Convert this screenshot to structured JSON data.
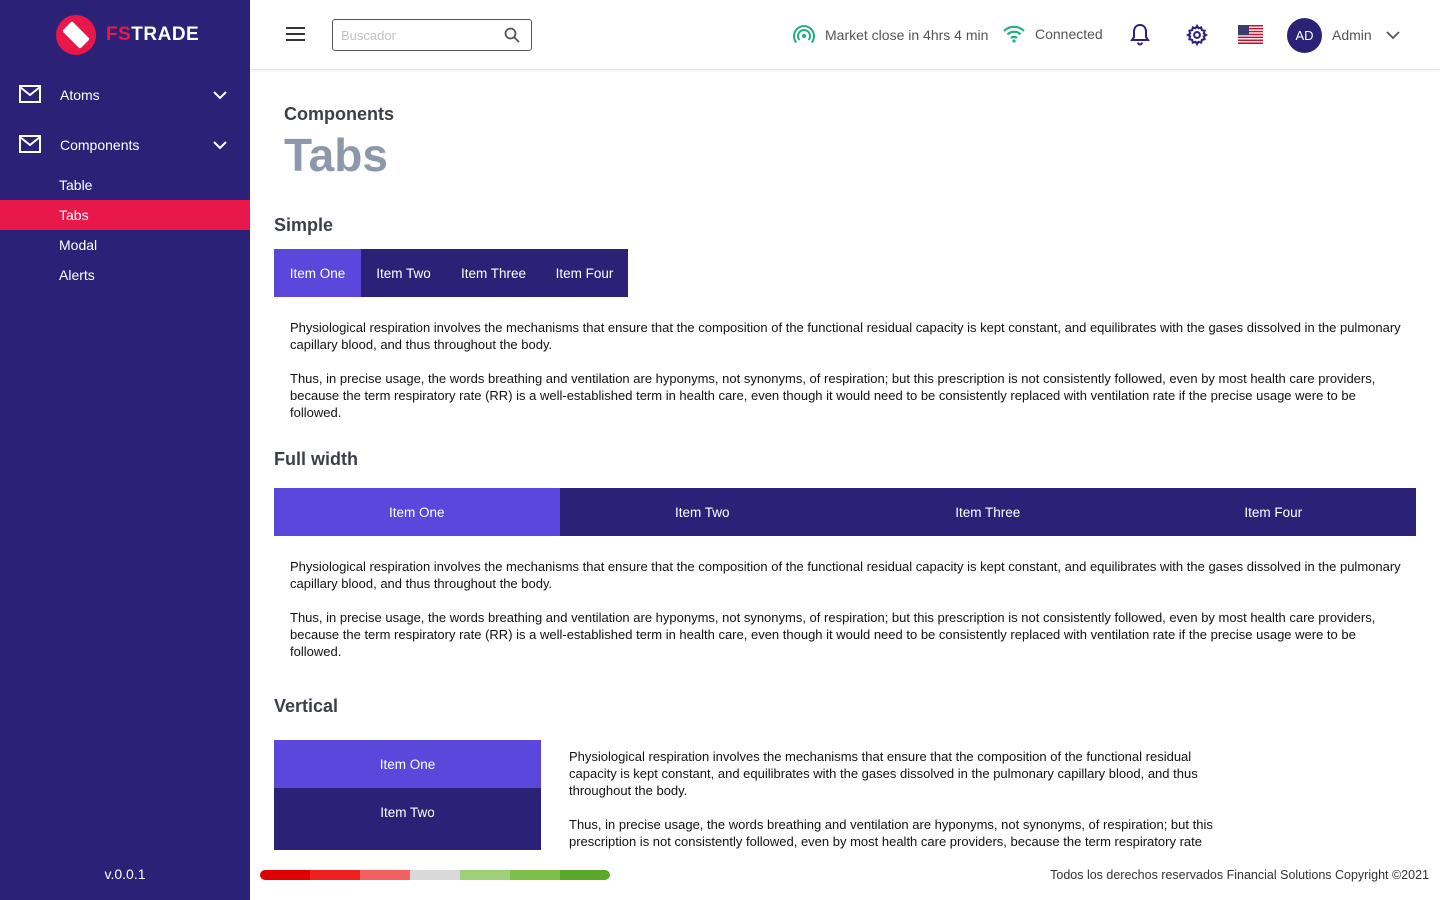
{
  "brand": {
    "prefix": "FS",
    "suffix": "TRADE"
  },
  "sidebar": {
    "groups": [
      {
        "label": "Atoms",
        "icon": "mail-icon"
      },
      {
        "label": "Components",
        "icon": "mail-icon"
      }
    ],
    "items": [
      {
        "label": "Table",
        "active": false
      },
      {
        "label": "Tabs",
        "active": true
      },
      {
        "label": "Modal",
        "active": false
      },
      {
        "label": "Alerts",
        "active": false
      }
    ],
    "version": "v.0.0.1"
  },
  "header": {
    "search_placeholder": "Buscador",
    "search_value": "",
    "market": "Market close in 4hrs 4 min",
    "connection": "Connected",
    "avatar_initials": "AD",
    "user_name": "Admin"
  },
  "page": {
    "breadcrumb": "Components",
    "title": "Tabs"
  },
  "sections": {
    "simple": {
      "title": "Simple",
      "tabs": [
        "Item One",
        "Item Two",
        "Item Three",
        "Item Four"
      ],
      "active_tab": 0,
      "paragraphs": [
        "Physiological respiration involves the mechanisms that ensure that the composition of the functional residual capacity is kept constant, and equilibrates with the gases dissolved in the pulmonary capillary blood, and thus throughout the body.",
        "Thus, in precise usage, the words breathing and ventilation are hyponyms, not synonyms, of respiration; but this prescription is not consistently followed, even by most health care providers, because the term respiratory rate (RR) is a well-established term in health care, even though it would need to be consistently replaced with ventilation rate if the precise usage were to be followed."
      ]
    },
    "full_width": {
      "title": "Full width",
      "tabs": [
        "Item One",
        "Item Two",
        "Item Three",
        "Item Four"
      ],
      "active_tab": 0,
      "paragraphs": [
        "Physiological respiration involves the mechanisms that ensure that the composition of the functional residual capacity is kept constant, and equilibrates with the gases dissolved in the pulmonary capillary blood, and thus throughout the body.",
        "Thus, in precise usage, the words breathing and ventilation are hyponyms, not synonyms, of respiration; but this prescription is not consistently followed, even by most health care providers, because the term respiratory rate (RR) is a well-established term in health care, even though it would need to be consistently replaced with ventilation rate if the precise usage were to be followed."
      ]
    },
    "vertical": {
      "title": "Vertical",
      "tabs": [
        "Item One",
        "Item Two"
      ],
      "active_tab": 0,
      "paragraphs": [
        "Physiological respiration involves the mechanisms that ensure that the composition of the functional residual capacity is kept constant, and equilibrates with the gases dissolved in the pulmonary capillary blood, and thus throughout the body.",
        "Thus, in precise usage, the words breathing and ventilation are hyponyms, not synonyms, of respiration; but this prescription is not consistently followed, even by most health care providers, because the term respiratory rate"
      ]
    }
  },
  "footer": {
    "copyright": "Todos los derechos reservados Financial Solutions Copyright ©2021",
    "risk_colors": [
      "#e00000",
      "#f02020",
      "#f46060",
      "#d9d9d9",
      "#9ed07a",
      "#7cc04a",
      "#5aa82a"
    ]
  },
  "colors": {
    "sidebar_bg": "#2b2278",
    "accent": "#e8194a",
    "tab_active": "#5b47db",
    "tab_bg": "#2b2278",
    "market_icon": "#23b07d",
    "wifi_icon": "#23b07d"
  }
}
